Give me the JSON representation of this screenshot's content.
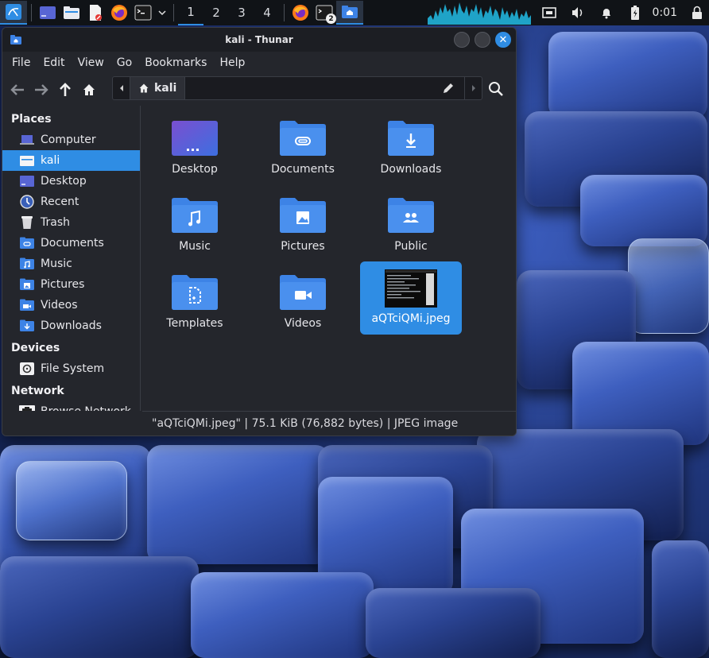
{
  "panel": {
    "workspaces": [
      "1",
      "2",
      "3",
      "4"
    ],
    "active_workspace_index": 0,
    "terminal_badge": "2",
    "clock": "0:01"
  },
  "window": {
    "title": "kali - Thunar"
  },
  "menu": [
    "File",
    "Edit",
    "View",
    "Go",
    "Bookmarks",
    "Help"
  ],
  "pathbar": {
    "current": "kali"
  },
  "sidebar": {
    "places_heading": "Places",
    "places": [
      {
        "label": "Computer",
        "icon": "computer-icon"
      },
      {
        "label": "kali",
        "icon": "home-folder-icon",
        "selected": true
      },
      {
        "label": "Desktop",
        "icon": "desktop-icon"
      },
      {
        "label": "Recent",
        "icon": "recent-icon"
      },
      {
        "label": "Trash",
        "icon": "trash-icon"
      },
      {
        "label": "Documents",
        "icon": "documents-folder-icon"
      },
      {
        "label": "Music",
        "icon": "music-folder-icon"
      },
      {
        "label": "Pictures",
        "icon": "pictures-folder-icon"
      },
      {
        "label": "Videos",
        "icon": "videos-folder-icon"
      },
      {
        "label": "Downloads",
        "icon": "downloads-folder-icon"
      }
    ],
    "devices_heading": "Devices",
    "devices": [
      {
        "label": "File System",
        "icon": "drive-icon"
      }
    ],
    "network_heading": "Network",
    "network": [
      {
        "label": "Browse Network",
        "icon": "network-icon"
      }
    ]
  },
  "files": [
    {
      "name": "Desktop",
      "icon": "desktop-folder-icon"
    },
    {
      "name": "Documents",
      "icon": "documents-folder-icon"
    },
    {
      "name": "Downloads",
      "icon": "downloads-folder-icon"
    },
    {
      "name": "Music",
      "icon": "music-folder-icon"
    },
    {
      "name": "Pictures",
      "icon": "pictures-folder-icon"
    },
    {
      "name": "Public",
      "icon": "public-folder-icon"
    },
    {
      "name": "Templates",
      "icon": "templates-folder-icon"
    },
    {
      "name": "Videos",
      "icon": "videos-folder-icon"
    },
    {
      "name": "aQTciQMi.jpeg",
      "icon": "image-thumbnail-icon",
      "selected": true
    }
  ],
  "status": "\"aQTciQMi.jpeg\" | 75.1 KiB (76,882 bytes) | JPEG image",
  "colors": {
    "accent": "#2f8de4",
    "folder": "#3d83e6",
    "window_bg": "#24262c",
    "panel_bg": "#101317"
  }
}
